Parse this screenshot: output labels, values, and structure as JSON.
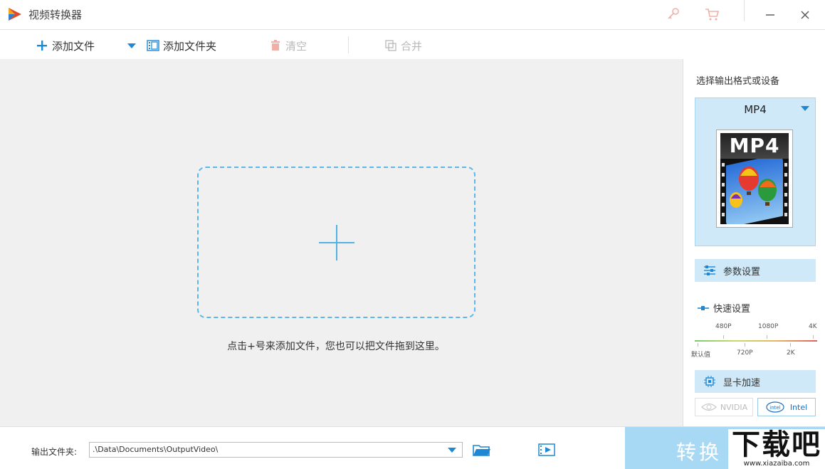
{
  "window": {
    "title": "视频转换器",
    "icons": [
      "key-icon",
      "cart-icon",
      "minimize-icon",
      "close-icon"
    ]
  },
  "toolbar": {
    "add_file": "添加文件",
    "add_folder": "添加文件夹",
    "clear": "清空",
    "merge": "合并"
  },
  "main": {
    "hint": "点击+号来添加文件，您也可以把文件拖到这里。"
  },
  "panel": {
    "label": "选择输出格式或设备",
    "format": "MP4",
    "format_image_text": "MP4",
    "params": "参数设置",
    "quick": "快速设置",
    "quality_top": [
      "480P",
      "1080P",
      "4K"
    ],
    "quality_bottom": [
      "默认值",
      "720P",
      "2K"
    ],
    "gpu_accel": "显卡加速",
    "gpu_nvidia": "NVIDIA",
    "gpu_intel": "Intel"
  },
  "bottom": {
    "output_label": "输出文件夹:",
    "output_path": ".\\Data\\Documents\\OutputVideo\\",
    "convert": "转换"
  },
  "watermark": {
    "big": "下载吧",
    "small": "www.xiazaiba.com"
  },
  "colors": {
    "accent": "#1e88d4",
    "panel_highlight": "#cfe9f8",
    "dropzone_border": "#5ab8e8",
    "convert_bg": "#a8d9f4"
  }
}
